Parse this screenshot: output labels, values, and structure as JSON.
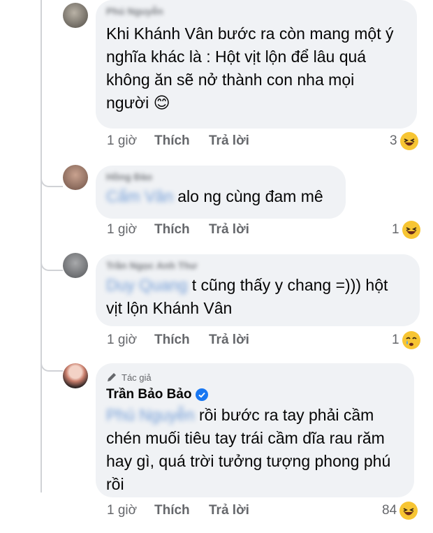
{
  "comments": [
    {
      "author": "Phú Nguyễn",
      "mention": "",
      "text_lines": [
        "Khi Khánh Vân bước ra còn mang một ý",
        "nghĩa khác là : Hột vịt lộn để lâu quá",
        "không ăn sẽ nở thành con nha mọi",
        "người 😊"
      ],
      "time": "1 giờ",
      "like": "Thích",
      "reply": "Trả lời",
      "reaction_count": "3",
      "reaction": "laughing-emoji"
    },
    {
      "author": "Hồng Đào",
      "mention": "Cẩm Vân",
      "text_lines": [
        "alo ng cùng đam mê"
      ],
      "time": "1 giờ",
      "like": "Thích",
      "reply": "Trả lời",
      "reaction_count": "1",
      "reaction": "laughing-emoji"
    },
    {
      "author": "Trần Ngọc Anh Thư",
      "mention": "Duy Quang",
      "text_lines": [
        "t cũng thấy y chang =))) hột",
        "vịt lộn Khánh Vân"
      ],
      "time": "1 giờ",
      "like": "Thích",
      "reply": "Trả lời",
      "reaction_count": "1",
      "reaction": "crying-laughing-emoji"
    },
    {
      "badge": "Tác giả",
      "author": "Trần Bảo Bảo",
      "verified": true,
      "mention": "Phú Nguyễn",
      "text_lines": [
        "rồi bước ra tay phải cầm",
        "chén muối tiêu tay trái cầm dĩa rau răm",
        "hay gì, quá trời tưởng tượng phong phú",
        "rồi"
      ],
      "time": "1 giờ",
      "like": "Thích",
      "reply": "Trả lời",
      "reaction_count": "84",
      "reaction": "laughing-emoji"
    }
  ],
  "colors": {
    "bubble": "#f0f2f5",
    "meta": "#65676b",
    "verified": "#1877f2",
    "emoji": "#f7c533"
  }
}
